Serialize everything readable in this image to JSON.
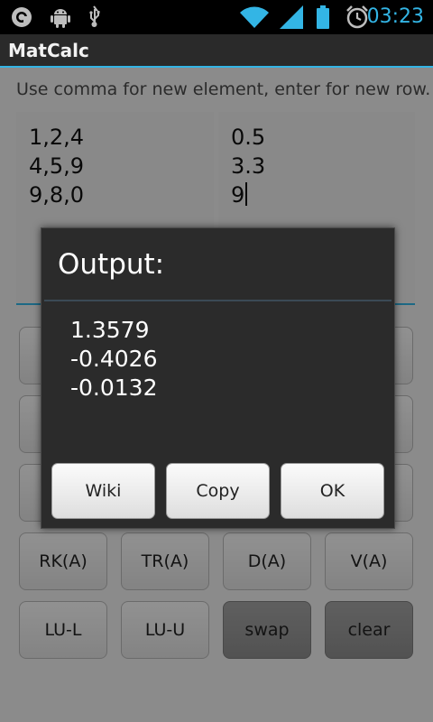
{
  "status_bar": {
    "time": "03:23",
    "icons": [
      "launcher-icon",
      "android-debug-icon",
      "usb-icon",
      "wifi-icon",
      "signal-icon",
      "battery-icon",
      "alarm-icon"
    ],
    "accent_color": "#33b5e5"
  },
  "app": {
    "title": "MatCalc"
  },
  "main": {
    "instruction": "Use comma for new element, enter for new row.",
    "matrix_a_lines": [
      "1,2,4",
      "4,5,9",
      "9,8,0"
    ],
    "matrix_b_lines": [
      "0.5",
      "3.3",
      "9"
    ]
  },
  "buttons": {
    "row4": [
      "RK(A)",
      "TR(A)",
      "D(A)",
      "V(A)"
    ],
    "row5": [
      "LU-L",
      "LU-U",
      "swap",
      "clear"
    ]
  },
  "dialog": {
    "title": "Output:",
    "output_lines": [
      "1.3579",
      "-0.4026",
      "-0.0132"
    ],
    "buttons": [
      "Wiki",
      "Copy",
      "OK"
    ]
  }
}
